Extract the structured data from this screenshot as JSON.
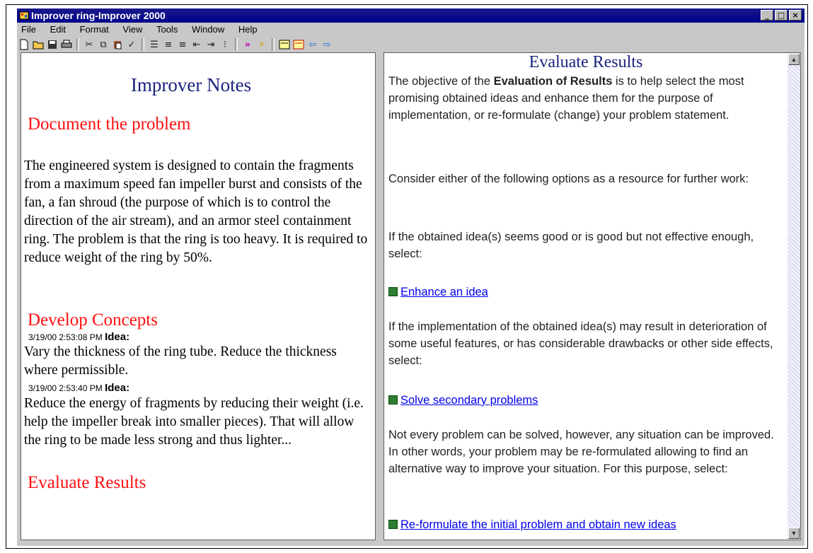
{
  "window": {
    "title": "Improver ring-Improver 2000",
    "minimize": "_",
    "maximize": "□",
    "close": "×"
  },
  "menu": [
    "File",
    "Edit",
    "Format",
    "View",
    "Tools",
    "Window",
    "Help"
  ],
  "toolbar": {
    "icons": [
      "new-icon",
      "open-icon",
      "save-icon",
      "print-icon",
      "cut-icon",
      "copy-icon",
      "paste-icon",
      "spellcheck-icon",
      "align-left-icon",
      "align-center-icon",
      "align-right-icon",
      "outdent-icon",
      "indent-icon",
      "bullets-icon",
      "forward-icon",
      "lightning-icon",
      "view1-icon",
      "view2-icon",
      "back-arrow-icon",
      "forward-arrow-icon"
    ]
  },
  "notes": {
    "title": "Improver Notes",
    "document_heading": "Document the problem",
    "document_body": "The engineered system is designed to contain the fragments from a maximum speed fan impeller burst and consists of the fan, a fan shroud (the purpose of which is to control the direction of the air stream), and an armor steel containment ring. The problem is that the ring is too heavy.  It is required to reduce weight of the ring by 50%.",
    "develop_heading": "Develop Concepts",
    "ideas": [
      {
        "timestamp": "3/19/00 2:53:08 PM",
        "label": "Idea:",
        "text": "Vary the thickness of the ring tube.  Reduce the thickness where permissible."
      },
      {
        "timestamp": "3/19/00 2:53:40 PM",
        "label": "Idea:",
        "text": "Reduce the energy of fragments by reducing their weight (i.e. help the impeller break into smaller pieces).  That will allow the ring to be made less strong and thus lighter..."
      }
    ],
    "evaluate_heading": "Evaluate Results"
  },
  "panel": {
    "title": "Evaluate Results",
    "intro_pre": "The objective of the ",
    "intro_bold": "Evaluation of Results",
    "intro_post": " is to help select the most promising obtained ideas and enhance them for the purpose of implementation, or re-formulate (change) your problem statement.",
    "consider": "Consider either of the following options as a resource for further work:",
    "if_good": "If the obtained idea(s) seems good or is good but not effective enough, select:",
    "link_enhance": "Enhance an idea",
    "if_implementation": "If the implementation of the obtained idea(s) may result in deterioration of some useful features, or has considerable drawbacks or other side effects, select:",
    "link_secondary": "Solve secondary problems",
    "not_every": "Not every problem can be solved, however, any situation can be improved. In other words, your problem may be re-formulated allowing to find an alternative way to improve your situation. For this purpose, select:",
    "link_reformulate": "Re-formulate the initial problem and obtain new ideas"
  }
}
